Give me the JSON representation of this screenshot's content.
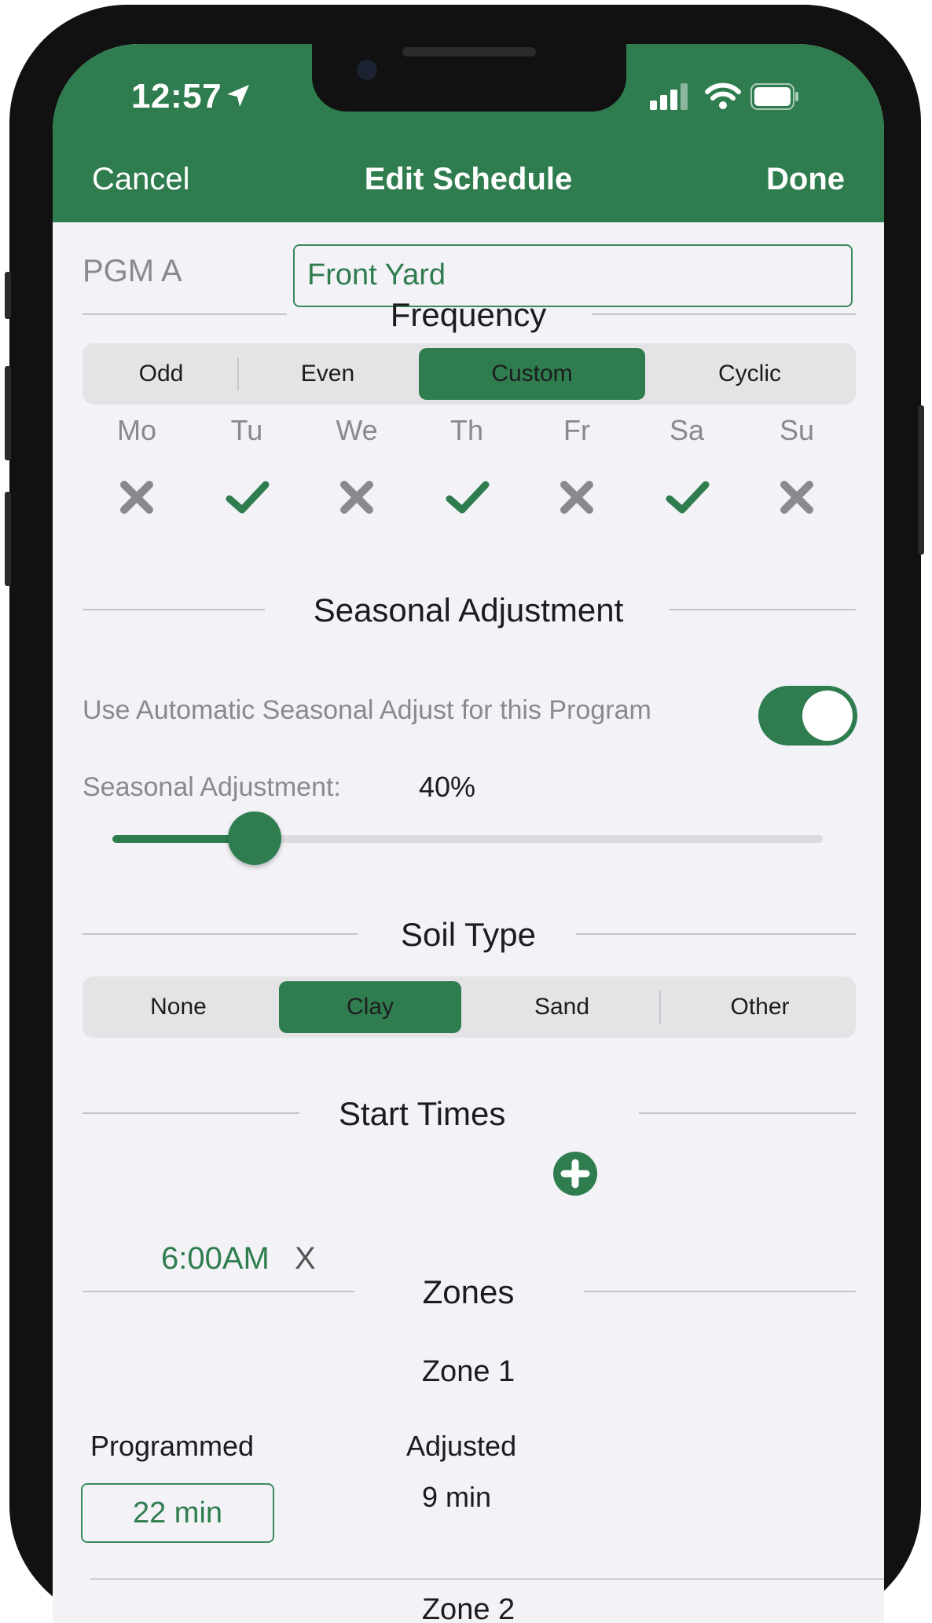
{
  "status_bar": {
    "time": "12:57"
  },
  "nav": {
    "cancel": "Cancel",
    "title": "Edit Schedule",
    "done": "Done"
  },
  "program": {
    "label": "PGM A",
    "name": "Front Yard"
  },
  "frequency": {
    "title": "Frequency",
    "options": [
      "Odd",
      "Even",
      "Custom",
      "Cyclic"
    ],
    "selected": "Custom",
    "days": [
      {
        "label": "Mo",
        "on": false
      },
      {
        "label": "Tu",
        "on": true
      },
      {
        "label": "We",
        "on": false
      },
      {
        "label": "Th",
        "on": true
      },
      {
        "label": "Fr",
        "on": false
      },
      {
        "label": "Sa",
        "on": true
      },
      {
        "label": "Su",
        "on": false
      }
    ]
  },
  "seasonal": {
    "title": "Seasonal Adjustment",
    "toggle_label": "Use Automatic Seasonal Adjust for this Program",
    "toggle_on": true,
    "adjust_label": "Seasonal Adjustment:",
    "adjust_value": "40%",
    "slider_fraction": 0.2
  },
  "soil": {
    "title": "Soil Type",
    "options": [
      "None",
      "Clay",
      "Sand",
      "Other"
    ],
    "selected": "Clay"
  },
  "start_times": {
    "title": "Start Times",
    "items": [
      {
        "time": "6:00AM",
        "remove": "X"
      }
    ]
  },
  "zones": {
    "title": "Zones",
    "items": [
      {
        "name": "Zone 1",
        "programmed_label": "Programmed",
        "programmed": "22 min",
        "adjusted_label": "Adjusted",
        "adjusted": "9 min"
      },
      {
        "name": "Zone 2"
      }
    ]
  },
  "colors": {
    "accent": "#2f7d4f",
    "background": "#f2f2f7"
  }
}
